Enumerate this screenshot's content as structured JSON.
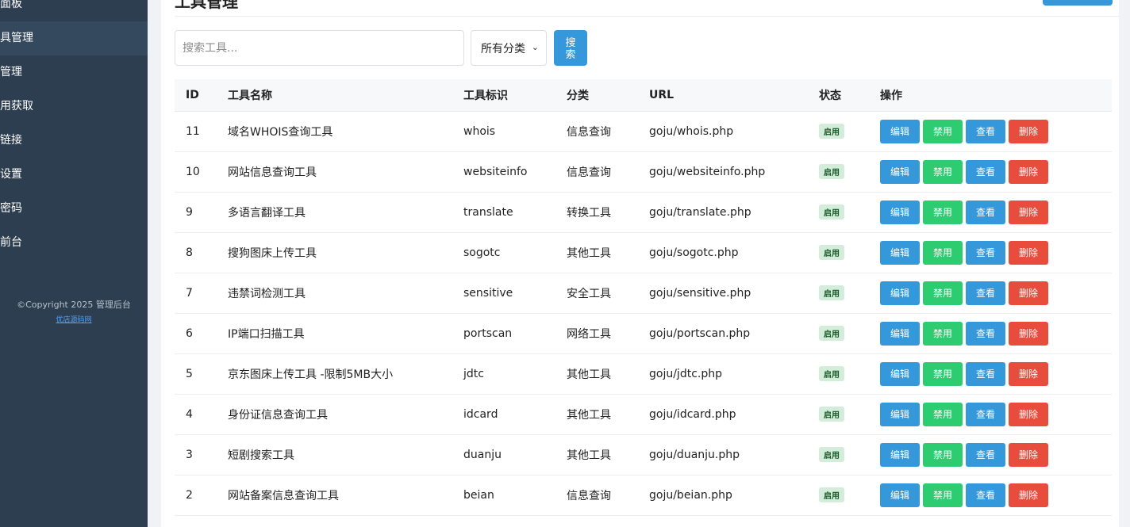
{
  "sidebar": {
    "items": [
      {
        "label": "制面板",
        "active": false
      },
      {
        "label": "工具管理",
        "active": true
      },
      {
        "label": "类管理",
        "active": false
      },
      {
        "label": "应用获取",
        "active": false
      },
      {
        "label": "情链接",
        "active": false
      },
      {
        "label": "点设置",
        "active": false
      },
      {
        "label": "改密码",
        "active": false
      },
      {
        "label": "问前台",
        "active": false
      }
    ],
    "copyright": "©Copyright 2025 管理后台",
    "copyright_link": "优店源码网"
  },
  "main": {
    "title": "工具管理",
    "search_placeholder": "搜索工具...",
    "category_selected": "所有分类",
    "search_button": "搜索",
    "columns": [
      "ID",
      "工具名称",
      "工具标识",
      "分类",
      "URL",
      "状态",
      "操作"
    ],
    "rows": [
      {
        "id": "11",
        "name": "域名WHOIS查询工具",
        "slug": "whois",
        "category": "信息查询",
        "url": "goju/whois.php",
        "status": "启用"
      },
      {
        "id": "10",
        "name": "网站信息查询工具",
        "slug": "websiteinfo",
        "category": "信息查询",
        "url": "goju/websiteinfo.php",
        "status": "启用"
      },
      {
        "id": "9",
        "name": "多语言翻译工具",
        "slug": "translate",
        "category": "转换工具",
        "url": "goju/translate.php",
        "status": "启用"
      },
      {
        "id": "8",
        "name": "搜狗图床上传工具",
        "slug": "sogotc",
        "category": "其他工具",
        "url": "goju/sogotc.php",
        "status": "启用"
      },
      {
        "id": "7",
        "name": "违禁词检测工具",
        "slug": "sensitive",
        "category": "安全工具",
        "url": "goju/sensitive.php",
        "status": "启用"
      },
      {
        "id": "6",
        "name": "IP端口扫描工具",
        "slug": "portscan",
        "category": "网络工具",
        "url": "goju/portscan.php",
        "status": "启用"
      },
      {
        "id": "5",
        "name": "京东图床上传工具 -限制5MB大小",
        "slug": "jdtc",
        "category": "其他工具",
        "url": "goju/jdtc.php",
        "status": "启用"
      },
      {
        "id": "4",
        "name": "身份证信息查询工具",
        "slug": "idcard",
        "category": "其他工具",
        "url": "goju/idcard.php",
        "status": "启用"
      },
      {
        "id": "3",
        "name": "短剧搜索工具",
        "slug": "duanju",
        "category": "其他工具",
        "url": "goju/duanju.php",
        "status": "启用"
      },
      {
        "id": "2",
        "name": "网站备案信息查询工具",
        "slug": "beian",
        "category": "信息查询",
        "url": "goju/beian.php",
        "status": "启用"
      }
    ],
    "actions": {
      "edit": "编辑",
      "disable": "禁用",
      "view": "查看",
      "delete": "删除"
    }
  },
  "colors": {
    "sidebar_bg": "#2c3e50",
    "sidebar_active": "#34495e",
    "primary": "#3498db",
    "success": "#2ecc71",
    "danger": "#e74c3c",
    "badge_bg": "#d4edda"
  }
}
